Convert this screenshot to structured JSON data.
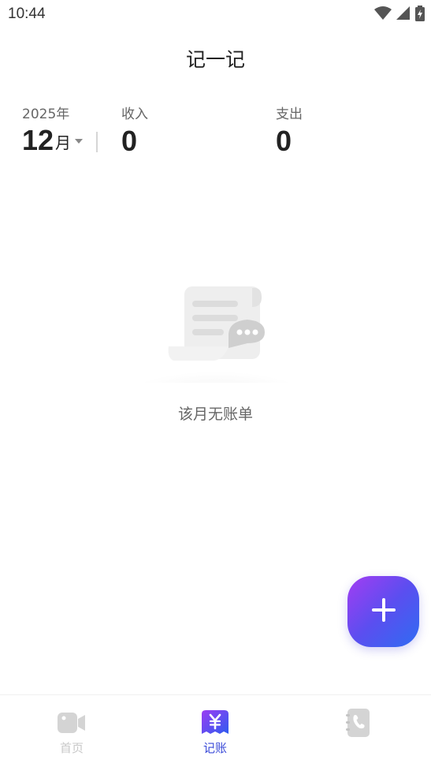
{
  "status_bar": {
    "time": "10:44"
  },
  "header": {
    "title": "记一记"
  },
  "summary": {
    "year": "2025年",
    "month_number": "12",
    "month_suffix": "月",
    "income_label": "收入",
    "income_value": "0",
    "expense_label": "支出",
    "expense_value": "0"
  },
  "empty_state": {
    "message": "该月无账单"
  },
  "fab": {
    "icon": "plus-icon"
  },
  "bottom_nav": {
    "items": [
      {
        "label": "首页",
        "icon": "video-camera-icon",
        "active": false
      },
      {
        "label": "记账",
        "icon": "yen-ledger-icon",
        "active": true
      },
      {
        "label": "",
        "icon": "phone-book-icon",
        "active": false
      }
    ]
  },
  "colors": {
    "accent": "#3a4ad8",
    "fab_gradient_start": "#a33df2",
    "fab_gradient_end": "#2f6cf2",
    "inactive": "#c8c8c8"
  }
}
